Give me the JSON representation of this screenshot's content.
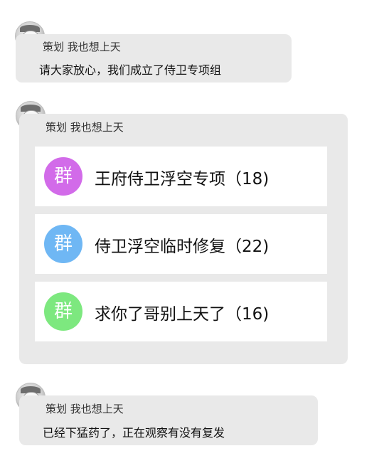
{
  "messages": [
    {
      "sender": "策划 我也想上天",
      "text": "请大家放心，我们成立了侍卫专项组",
      "avatar_icon": "anime-avatar-icon"
    },
    {
      "sender": "策划 我也想上天",
      "avatar_icon": "anime-avatar-icon",
      "group_cards": [
        {
          "icon_label": "群",
          "icon_color": "#d26be9",
          "name": "王府侍卫浮空专项（18)"
        },
        {
          "icon_label": "群",
          "icon_color": "#6fb7f4",
          "name": "侍卫浮空临时修复（22)"
        },
        {
          "icon_label": "群",
          "icon_color": "#7de87f",
          "name": "求你了哥别上天了（16)"
        }
      ]
    },
    {
      "sender": "策划 我也想上天",
      "text": "已经下猛药了，正在观察有没有复发",
      "avatar_icon": "anime-avatar-icon"
    }
  ],
  "colors": {
    "bubble_bg": "#e9e9e9",
    "card_bg": "#ffffff",
    "page_bg": "#ffffff"
  }
}
